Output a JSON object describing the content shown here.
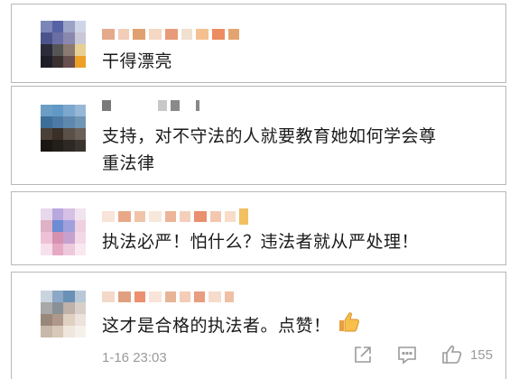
{
  "comments": [
    {
      "text": "干得漂亮"
    },
    {
      "text_line1": "支持，对不守法的人就要教育她如何学会尊",
      "text_line2": "重法律"
    },
    {
      "text": "执法必严！怕什么？违法者就从严处理！"
    },
    {
      "text": "这才是合格的执法者。点赞！",
      "emoji": "thumbs-up-emoji",
      "time": "1-16 23:03",
      "like_count": "155"
    }
  ],
  "icons": [
    "share-icon",
    "comment-icon",
    "like-icon"
  ],
  "colors": {
    "text": "#1a1a1a",
    "meta": "#9a9a9a",
    "border": "#b8b8b8"
  }
}
